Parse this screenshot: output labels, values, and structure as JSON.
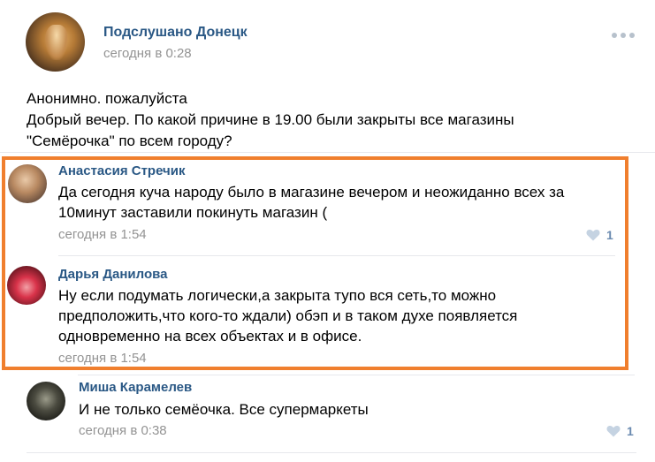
{
  "post": {
    "group_name": "Подслушано Донецк",
    "time": "сегодня в 0:28",
    "text_lines": [
      "Анонимно. пожалуйста",
      "Добрый вечер. По какой причине в 19.00 были закрыты все магазины",
      "\"Семёрочка\" по всем городу?"
    ]
  },
  "comments": [
    {
      "author": "Анастасия Стречик",
      "text_lines": [
        "Да сегодня куча народу было в магазине вечером и неожиданно всех за",
        "10минут заставили покинуть магазин ("
      ],
      "time": "сегодня в 1:54",
      "likes": "1"
    },
    {
      "author": "Дарья Данилова",
      "text_lines": [
        "Ну если подумать логически,а закрыта тупо вся сеть,то можно",
        "предположить,что кого-то ждали) обэп и в таком духе появляется",
        "одновременно на всех объектах и в офисе."
      ],
      "time": "сегодня в 1:54",
      "likes": ""
    },
    {
      "author": "Миша Карамелев",
      "text_lines": [
        "И не только семёочка. Все супермаркеты"
      ],
      "time": "сегодня в 0:38",
      "likes": "1"
    }
  ],
  "colors": {
    "link": "#2a5885",
    "meta": "#939393",
    "highlight_border": "#f07f2e",
    "like": "#6a8ab0"
  },
  "icons": {
    "more": "more-horizontal-icon",
    "like": "heart-icon"
  }
}
